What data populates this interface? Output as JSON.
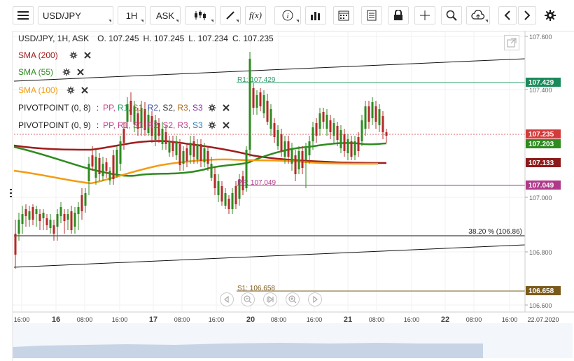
{
  "toolbar": {
    "symbol": "USD/JPY",
    "interval": "1H",
    "price_type": "ASK"
  },
  "header": {
    "pair": "USD/JPY, 1H, ASK",
    "open": "O. 107.245",
    "high": "H. 107.245",
    "low": "L. 107.234",
    "close": "C. 107.235"
  },
  "indicators": [
    {
      "label": "SMA (200)",
      "color": "#a01c1c"
    },
    {
      "label": "SMA (55)",
      "color": "#2e8b1f"
    },
    {
      "label": "SMA (100)",
      "color": "#f39c12"
    }
  ],
  "pivots": [
    {
      "label": "PIVOTPOINT (0, 8)",
      "sep": ":",
      "items": [
        {
          "t": "PP,",
          "c": "#c0408a"
        },
        {
          "t": "R1,",
          "c": "#2aa06a"
        },
        {
          "t": "S1,",
          "c": "#8a6d2c"
        },
        {
          "t": "R2,",
          "c": "#3b4fb0"
        },
        {
          "t": "S2,",
          "c": "#333333"
        },
        {
          "t": "R3,",
          "c": "#b06a1a"
        },
        {
          "t": "S3",
          "c": "#8a2bb0"
        }
      ]
    },
    {
      "label": "PIVOTPOINT (0, 9)",
      "sep": ":",
      "items": [
        {
          "t": "PP,",
          "c": "#c0408a"
        },
        {
          "t": "R1,",
          "c": "#c0408a"
        },
        {
          "t": "S1,",
          "c": "#c0408a"
        },
        {
          "t": "R2,",
          "c": "#c0408a"
        },
        {
          "t": "S2,",
          "c": "#c0408a"
        },
        {
          "t": "R3,",
          "c": "#c0408a"
        },
        {
          "t": "S3",
          "c": "#2a7ab0"
        }
      ]
    }
  ],
  "annotations": {
    "r1": "R1: 107.429",
    "pp": "PP: 107.049",
    "s1": "S1: 106.658",
    "fib": "38.20 % (106.86)"
  },
  "price_axis": {
    "ticks": [
      "107.600",
      "107.400",
      "107.000",
      "106.800",
      "106.600"
    ],
    "tags": [
      {
        "text": "107.429",
        "bg": "#1a8a5a"
      },
      {
        "text": "107.235",
        "bg": "#d23b3b"
      },
      {
        "text": "107.203",
        "bg": "#2e8b1f"
      },
      {
        "text": "107.133",
        "bg": "#8b1a1a"
      },
      {
        "text": "107.049",
        "bg": "#b0388a"
      },
      {
        "text": "106.658",
        "bg": "#7a5a1a"
      }
    ]
  },
  "time_axis": {
    "labels": [
      {
        "t": "16:00",
        "b": false
      },
      {
        "t": "16",
        "b": true
      },
      {
        "t": "08:00",
        "b": false
      },
      {
        "t": "16:00",
        "b": false
      },
      {
        "t": "17",
        "b": true
      },
      {
        "t": "08:00",
        "b": false
      },
      {
        "t": "16:00",
        "b": false
      },
      {
        "t": "20",
        "b": true
      },
      {
        "t": "08:00",
        "b": false
      },
      {
        "t": "16:00",
        "b": false
      },
      {
        "t": "21",
        "b": true
      },
      {
        "t": "08:00",
        "b": false
      },
      {
        "t": "16:00",
        "b": false
      },
      {
        "t": "22",
        "b": true
      },
      {
        "t": "08:00",
        "b": false
      },
      {
        "t": "16:00",
        "b": false
      },
      {
        "t": "22.07.2020",
        "b": false
      }
    ]
  },
  "colors": {
    "sma200": "#a01c1c",
    "sma55": "#2e8b1f",
    "sma100": "#f39c12",
    "up": "#2e8b1f",
    "down": "#b52a2a"
  }
}
